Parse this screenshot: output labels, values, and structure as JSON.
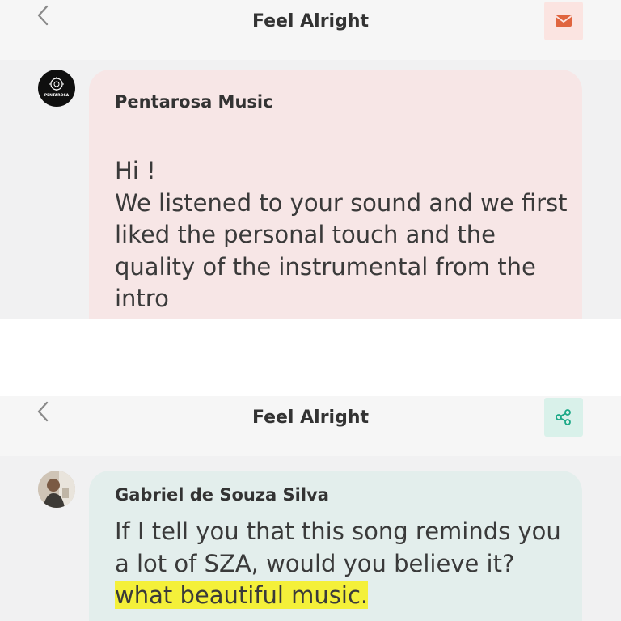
{
  "panels": [
    {
      "header": {
        "back_label": "<",
        "title": "Feel Alright",
        "action_icon": "mail-icon",
        "action_bg": "#fbe4e1",
        "action_color": "#e0653f"
      },
      "message": {
        "sender": "Pentarosa Music",
        "avatar_text": "PENTAROSA",
        "bubble_color": "#f7e6e6",
        "lines": [
          "Hi !",
          "We listened to your sound and we first liked the personal touch and the quality of the instrumental from the intro"
        ]
      }
    },
    {
      "header": {
        "back_label": "<",
        "title": "Feel Alright",
        "action_icon": "share-icon",
        "action_bg": "#d9f1ea",
        "action_color": "#1aa886"
      },
      "message": {
        "sender": "Gabriel de Souza Silva",
        "bubble_color": "#e3eeec",
        "text_plain": "If I tell you that this song reminds you a lot of SZA, would you believe it? ",
        "text_highlighted": "what beautiful music."
      }
    }
  ]
}
